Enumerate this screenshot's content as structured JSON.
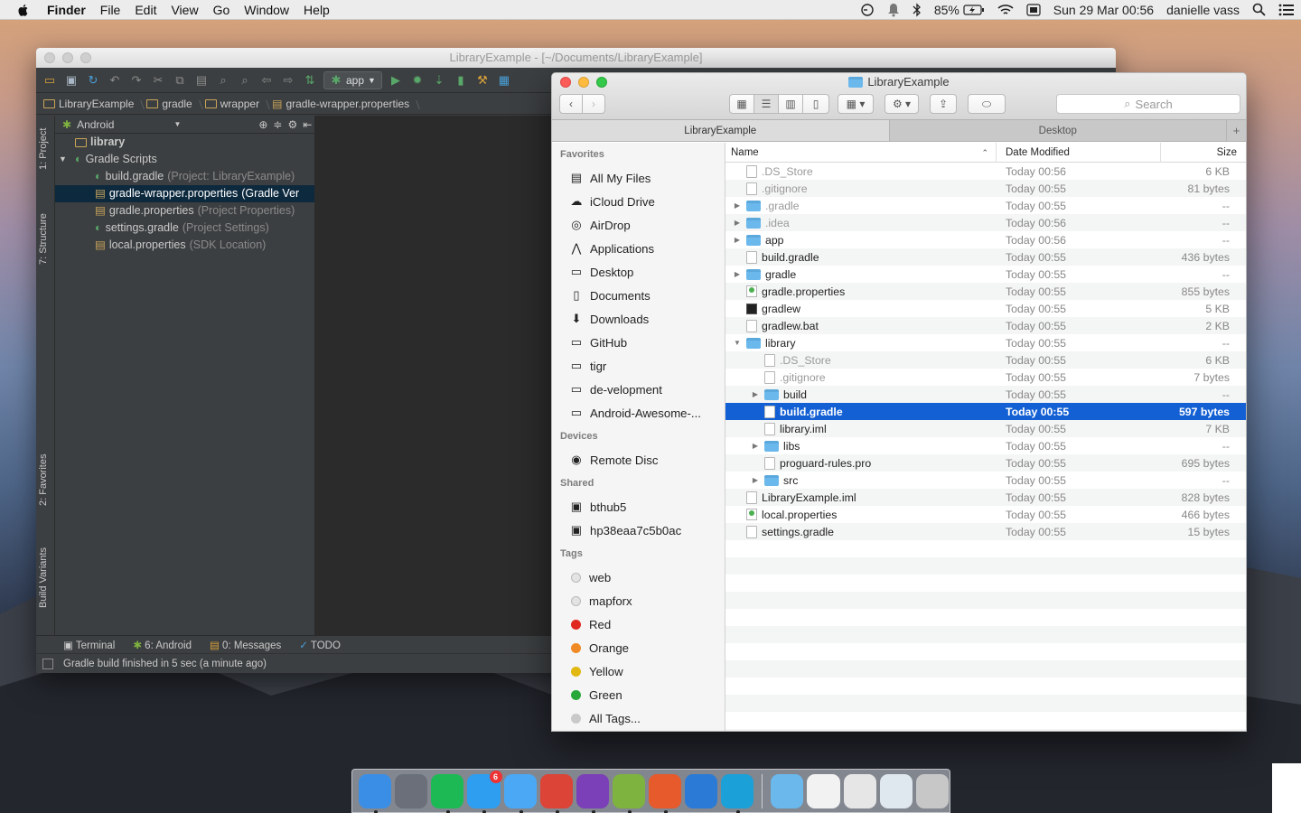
{
  "menubar": {
    "app": "Finder",
    "items": [
      "File",
      "Edit",
      "View",
      "Go",
      "Window",
      "Help"
    ],
    "battery": "85%",
    "datetime": "Sun 29 Mar  00:56",
    "user": "danielle vass"
  },
  "android_studio": {
    "title": "LibraryExample - [~/Documents/LibraryExample]",
    "run_config": "app",
    "breadcrumbs": [
      "LibraryExample",
      "gradle",
      "wrapper",
      "gradle-wrapper.properties"
    ],
    "view_selector": "Android",
    "side_tabs": {
      "project": "1: Project",
      "structure": "7: Structure",
      "favorites": "2: Favorites",
      "variants": "Build Variants"
    },
    "tree": [
      {
        "label": "library",
        "note": ""
      },
      {
        "label": "Gradle Scripts",
        "note": ""
      },
      {
        "label": "build.gradle",
        "note": "(Project: LibraryExample)"
      },
      {
        "label": "gradle-wrapper.properties",
        "note": "(Gradle Ver"
      },
      {
        "label": "gradle.properties",
        "note": "(Project Properties)"
      },
      {
        "label": "settings.gradle",
        "note": "(Project Settings)"
      },
      {
        "label": "local.properties",
        "note": "(SDK Location)"
      }
    ],
    "bottom_tabs": [
      "Terminal",
      "6: Android",
      "0: Messages",
      "TODO"
    ],
    "status": "Gradle build finished in 5 sec (a minute ago)"
  },
  "finder": {
    "title": "LibraryExample",
    "search_placeholder": "Search",
    "tabs": [
      "LibraryExample",
      "Desktop"
    ],
    "columns": {
      "name": "Name",
      "date": "Date Modified",
      "size": "Size"
    },
    "sections": {
      "favorites": "Favorites",
      "devices": "Devices",
      "shared": "Shared",
      "tags": "Tags"
    },
    "favorites": [
      "All My Files",
      "iCloud Drive",
      "AirDrop",
      "Applications",
      "Desktop",
      "Documents",
      "Downloads",
      "GitHub",
      "tigr",
      "de-velopment",
      "Android-Awesome-..."
    ],
    "devices": [
      "Remote Disc"
    ],
    "shared": [
      "bthub5",
      "hp38eaa7c5b0ac"
    ],
    "tags": [
      {
        "label": "web",
        "color": "#e3e3e3"
      },
      {
        "label": "mapforx",
        "color": "#e3e3e3"
      },
      {
        "label": "Red",
        "color": "#e0291f"
      },
      {
        "label": "Orange",
        "color": "#f08a24"
      },
      {
        "label": "Yellow",
        "color": "#e1b711"
      },
      {
        "label": "Green",
        "color": "#29a83a"
      },
      {
        "label": "All Tags...",
        "color": "#c9c9c9"
      }
    ],
    "files": [
      {
        "name": ".DS_Store",
        "date": "Today 00:56",
        "size": "6 KB",
        "kind": "file",
        "indent": 0,
        "arrow": "",
        "dim": true
      },
      {
        "name": ".gitignore",
        "date": "Today 00:55",
        "size": "81 bytes",
        "kind": "file",
        "indent": 0,
        "arrow": "",
        "dim": true
      },
      {
        "name": ".gradle",
        "date": "Today 00:55",
        "size": "--",
        "kind": "folder",
        "indent": 0,
        "arrow": "▶",
        "dim": true
      },
      {
        "name": ".idea",
        "date": "Today 00:56",
        "size": "--",
        "kind": "folder",
        "indent": 0,
        "arrow": "▶",
        "dim": true
      },
      {
        "name": "app",
        "date": "Today 00:56",
        "size": "--",
        "kind": "folder",
        "indent": 0,
        "arrow": "▶",
        "dim": false
      },
      {
        "name": "build.gradle",
        "date": "Today 00:55",
        "size": "436 bytes",
        "kind": "file",
        "indent": 0,
        "arrow": "",
        "dim": false
      },
      {
        "name": "gradle",
        "date": "Today 00:55",
        "size": "--",
        "kind": "folder",
        "indent": 0,
        "arrow": "▶",
        "dim": false
      },
      {
        "name": "gradle.properties",
        "date": "Today 00:55",
        "size": "855 bytes",
        "kind": "green",
        "indent": 0,
        "arrow": "",
        "dim": false
      },
      {
        "name": "gradlew",
        "date": "Today 00:55",
        "size": "5 KB",
        "kind": "exec",
        "indent": 0,
        "arrow": "",
        "dim": false
      },
      {
        "name": "gradlew.bat",
        "date": "Today 00:55",
        "size": "2 KB",
        "kind": "file",
        "indent": 0,
        "arrow": "",
        "dim": false
      },
      {
        "name": "library",
        "date": "Today 00:55",
        "size": "--",
        "kind": "folder",
        "indent": 0,
        "arrow": "▼",
        "dim": false
      },
      {
        "name": ".DS_Store",
        "date": "Today 00:55",
        "size": "6 KB",
        "kind": "file",
        "indent": 1,
        "arrow": "",
        "dim": true
      },
      {
        "name": ".gitignore",
        "date": "Today 00:55",
        "size": "7 bytes",
        "kind": "file",
        "indent": 1,
        "arrow": "",
        "dim": true
      },
      {
        "name": "build",
        "date": "Today 00:55",
        "size": "--",
        "kind": "folder",
        "indent": 1,
        "arrow": "▶",
        "dim": false
      },
      {
        "name": "build.gradle",
        "date": "Today 00:55",
        "size": "597 bytes",
        "kind": "file",
        "indent": 1,
        "arrow": "",
        "dim": false,
        "selected": true
      },
      {
        "name": "library.iml",
        "date": "Today 00:55",
        "size": "7 KB",
        "kind": "file",
        "indent": 1,
        "arrow": "",
        "dim": false
      },
      {
        "name": "libs",
        "date": "Today 00:55",
        "size": "--",
        "kind": "folder",
        "indent": 1,
        "arrow": "▶",
        "dim": false
      },
      {
        "name": "proguard-rules.pro",
        "date": "Today 00:55",
        "size": "695 bytes",
        "kind": "file",
        "indent": 1,
        "arrow": "",
        "dim": false
      },
      {
        "name": "src",
        "date": "Today 00:55",
        "size": "--",
        "kind": "folder",
        "indent": 1,
        "arrow": "▶",
        "dim": false
      },
      {
        "name": "LibraryExample.iml",
        "date": "Today 00:55",
        "size": "828 bytes",
        "kind": "file",
        "indent": 0,
        "arrow": "",
        "dim": false
      },
      {
        "name": "local.properties",
        "date": "Today 00:55",
        "size": "466 bytes",
        "kind": "green",
        "indent": 0,
        "arrow": "",
        "dim": false
      },
      {
        "name": "settings.gradle",
        "date": "Today 00:55",
        "size": "15 bytes",
        "kind": "file",
        "indent": 0,
        "arrow": "",
        "dim": false
      }
    ]
  },
  "dock": {
    "apps": [
      {
        "icon": "finder-icon",
        "color": "#3b8ee6"
      },
      {
        "icon": "launchpad-icon",
        "color": "#6b6f7a"
      },
      {
        "icon": "spotify-icon",
        "color": "#1db954"
      },
      {
        "icon": "app-store-icon",
        "color": "#2d9ef0",
        "badge": "6"
      },
      {
        "icon": "messages-icon",
        "color": "#4aa8f5"
      },
      {
        "icon": "chrome-icon",
        "color": "#db4437"
      },
      {
        "icon": "github-icon",
        "color": "#7b3fb8"
      },
      {
        "icon": "android-studio-icon",
        "color": "#7fb33f"
      },
      {
        "icon": "sublime-icon",
        "color": "#e65a2c"
      },
      {
        "icon": "xcode-icon",
        "color": "#2b7bd6"
      },
      {
        "icon": "mou-icon",
        "color": "#1ba0d8"
      }
    ],
    "docs": [
      {
        "icon": "folder-stack-icon",
        "color": "#6ab8ec"
      },
      {
        "icon": "document-stack-icon",
        "color": "#f2f2f2"
      },
      {
        "icon": "screenshot-stack-icon",
        "color": "#e6e6e6"
      },
      {
        "icon": "document-preview-icon",
        "color": "#dfe7ef"
      },
      {
        "icon": "trash-icon",
        "color": "#c7c7c7"
      }
    ]
  }
}
